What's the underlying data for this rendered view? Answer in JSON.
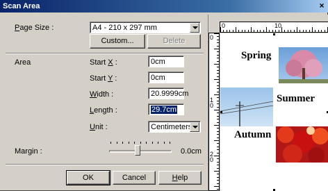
{
  "window": {
    "title": "Scan Area",
    "close_glyph": "×"
  },
  "page_size": {
    "label": "Page Size :",
    "value": "A4 - 210 x 297 mm"
  },
  "buttons": {
    "custom": "Custom...",
    "delete": "Delete",
    "ok": "OK",
    "cancel": "Cancel",
    "help": "Help"
  },
  "area": {
    "label": "Area",
    "start_x": {
      "label": "Start X :",
      "value": "0cm"
    },
    "start_y": {
      "label": "Start Y :",
      "value": "0cm"
    },
    "width": {
      "label": "Width :",
      "value": "20.9999cm"
    },
    "length": {
      "label": "Length :",
      "value": "29.7cm"
    },
    "unit": {
      "label": "Unit :",
      "value": "Centimeters"
    }
  },
  "margin": {
    "label": "Margin :",
    "value": "0.0cm",
    "slider_level_fraction": 0.45
  },
  "preview": {
    "ruler_h_labels": [
      "0",
      "10"
    ],
    "ruler_v_labels": [
      "0",
      "1\n0",
      "2\n0"
    ],
    "seasons": [
      "Spring",
      "Summer",
      "Autumn"
    ]
  },
  "colors": {
    "title_start": "#0a246a",
    "title_end": "#a6caf0",
    "face": "#d4d0c8",
    "selection": "#0a246a"
  }
}
